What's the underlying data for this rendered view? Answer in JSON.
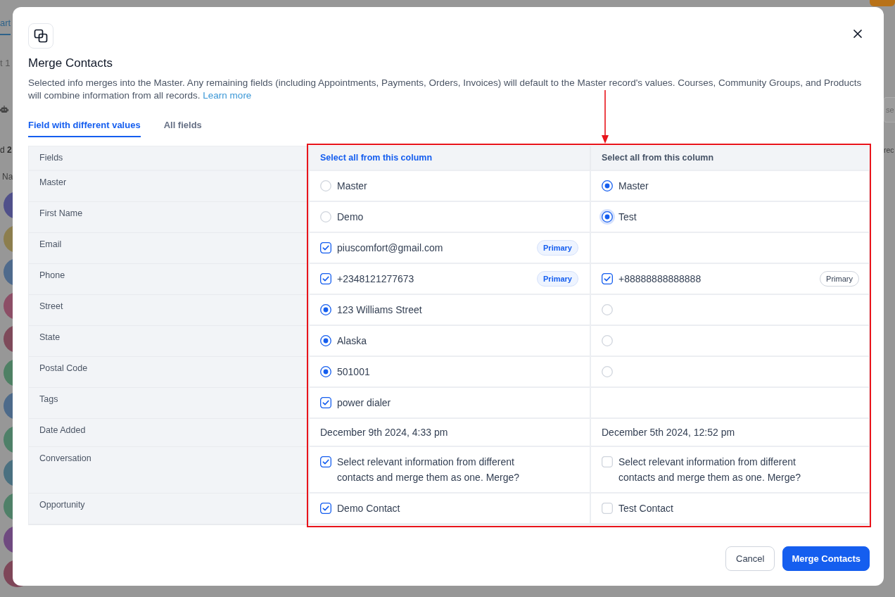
{
  "background": {
    "tab": {
      "label": "art",
      "selected": true
    },
    "count": "t 1",
    "selection": "d **2**",
    "column_header": "Na",
    "avatars": [
      {
        "color": "#50508a"
      },
      {
        "color": "#8c7e4e"
      },
      {
        "color": "#4e6a8c"
      },
      {
        "color": "#8c4e66"
      },
      {
        "color": "#7e4a5a"
      },
      {
        "color": "#4e8064"
      },
      {
        "color": "#4d6a8a"
      },
      {
        "color": "#4e8068"
      },
      {
        "color": "#4a7080"
      },
      {
        "color": "#4f8068"
      },
      {
        "color": "#6f4a80"
      },
      {
        "color": "#7e4658"
      }
    ],
    "search": {
      "placeholder": "se"
    },
    "row_text": "rec"
  },
  "dialog": {
    "title": "Merge Contacts",
    "description": "Selected info merges into the Master. Any remaining fields (including Appointments, Payments, Orders, Invoices) will default to the Master record's values. Courses, Community Groups, and Products will combine information from all records.",
    "link": "Learn more"
  },
  "tabs": [
    {
      "label": "Field with different values",
      "selected": true
    },
    {
      "label": "All fields",
      "selected": false
    }
  ],
  "table": {
    "header": "Fields",
    "columns": [
      {
        "select_all": "Select all from this column",
        "selected": true
      },
      {
        "select_all": "Select all from this column",
        "selected": false
      }
    ],
    "rows": [
      {
        "label": "Master",
        "cells": [
          {
            "kind": "radio",
            "checked": false,
            "focused": false,
            "text": "Master"
          },
          {
            "kind": "radio",
            "checked": true,
            "focused": false,
            "text": "Master"
          }
        ]
      },
      {
        "label": "First Name",
        "cells": [
          {
            "kind": "radio",
            "checked": false,
            "focused": false,
            "text": "Demo"
          },
          {
            "kind": "radio",
            "checked": true,
            "focused": true,
            "text": "Test"
          }
        ]
      },
      {
        "label": "Email",
        "cells": [
          {
            "kind": "checkbox",
            "checked": true,
            "focused": false,
            "text": "piuscomfort@gmail.com",
            "badge": {
              "text": "Primary",
              "active": true
            }
          },
          {
            "kind": "blank"
          }
        ]
      },
      {
        "label": "Phone",
        "cells": [
          {
            "kind": "checkbox",
            "checked": true,
            "focused": false,
            "text": "+2348121277673",
            "badge": {
              "text": "Primary",
              "active": true
            }
          },
          {
            "kind": "checkbox",
            "checked": true,
            "focused": false,
            "text": "+88888888888888",
            "badge": {
              "text": "Primary",
              "active": false
            }
          }
        ]
      },
      {
        "label": "Street",
        "cells": [
          {
            "kind": "radio",
            "checked": true,
            "focused": false,
            "text": "123 Williams Street"
          },
          {
            "kind": "radio",
            "checked": false,
            "focused": false
          }
        ]
      },
      {
        "label": "State",
        "cells": [
          {
            "kind": "radio",
            "checked": true,
            "focused": false,
            "text": "Alaska"
          },
          {
            "kind": "radio",
            "checked": false,
            "focused": false
          }
        ]
      },
      {
        "label": "Postal Code",
        "cells": [
          {
            "kind": "radio",
            "checked": true,
            "focused": false,
            "text": "501001"
          },
          {
            "kind": "radio",
            "checked": false,
            "focused": false
          }
        ]
      },
      {
        "label": "Tags",
        "cells": [
          {
            "kind": "checkbox",
            "checked": true,
            "focused": false,
            "text": "power dialer"
          },
          {
            "kind": "blank"
          }
        ]
      },
      {
        "label": "Date Added",
        "cells": [
          {
            "kind": "text",
            "text": "December 9th 2024, 4:33 pm"
          },
          {
            "kind": "text",
            "text": "December 5th 2024, 12:52 pm"
          }
        ]
      },
      {
        "label": "Conversation",
        "cells": [
          {
            "kind": "checkbox",
            "checked": true,
            "focused": false,
            "text": "Select relevant information from different contacts and merge them as one. Merge?"
          },
          {
            "kind": "checkbox",
            "checked": false,
            "focused": false,
            "text": "Select relevant information from different contacts and merge them as one. Merge?"
          }
        ]
      },
      {
        "label": "Opportunity",
        "cells": [
          {
            "kind": "checkbox",
            "checked": true,
            "focused": false,
            "text": "Demo Contact"
          },
          {
            "kind": "checkbox",
            "checked": false,
            "focused": false,
            "text": "Test Contact"
          }
        ]
      }
    ]
  },
  "annotation": {
    "frame": true,
    "arrow": true
  },
  "buttons": [
    {
      "label": "Cancel",
      "kind": "secondary"
    },
    {
      "label": "Merge Contacts",
      "kind": "primary"
    }
  ]
}
